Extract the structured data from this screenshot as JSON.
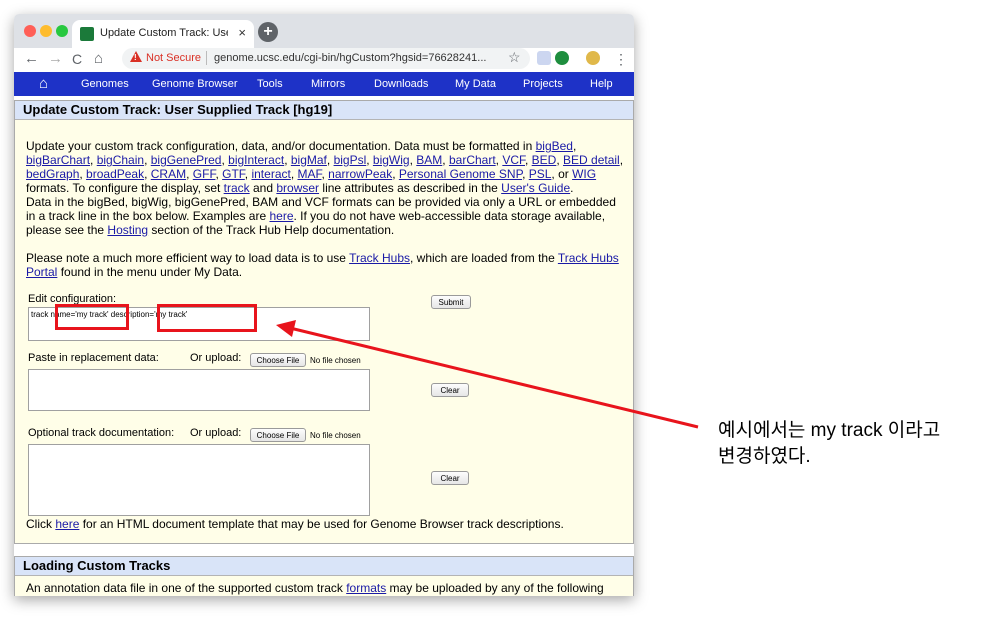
{
  "browser": {
    "tab_title": "Update Custom Track: User Su",
    "tab_close": "×",
    "new_tab": "+",
    "back": "←",
    "forward": "→",
    "reload": "C",
    "home": "⌂",
    "security_label": "Not Secure",
    "url": "genome.ucsc.edu/cgi-bin/hgCustom?hgsid=76628241...",
    "star": "☆",
    "menu": "⋮"
  },
  "nav": {
    "items": [
      "Genomes",
      "Genome Browser",
      "Tools",
      "Mirrors",
      "Downloads",
      "My Data",
      "Projects",
      "Help"
    ]
  },
  "page": {
    "panel_title": "Update Custom Track: User Supplied Track [hg19]",
    "intro": {
      "l1_text": "Update your custom track configuration, data, and/or documentation. Data must be formatted in ",
      "bigBed": "bigBed",
      "comma": ",",
      "bigBarChart": "bigBarChart",
      "bigChain": "bigChain",
      "bigGenePred": "bigGenePred",
      "bigInteract": "bigInteract",
      "bigMaf": "bigMaf",
      "bigPsl": "bigPsl",
      "bigWig": "bigWig",
      "BAM": "BAM",
      "barChart": "barChart",
      "VCF": "VCF",
      "BED": "BED",
      "BED_detail": "BED detail",
      "bedGraph": "bedGraph",
      "broadPeak": "broadPeak",
      "CRAM": "CRAM",
      "GFF": "GFF",
      "GTF": "GTF",
      "interact": "interact",
      "MAF": "MAF",
      "narrowPeak": "narrowPeak",
      "Personal_Genome_SNP": "Personal Genome SNP",
      "PSL": "PSL",
      "or": ", or ",
      "WIG": "WIG",
      "l4_a": "formats. To configure the display, set ",
      "track": "track",
      "and": " and ",
      "browser": "browser",
      "l4_b": " line attributes as described in the ",
      "users_guide": "User's Guide",
      "period": ".",
      "l5": "Data in the bigBed, bigWig, bigGenePred, BAM and VCF formats can be provided via only a URL or embedded",
      "l6_a": "in a track line in the box below. Examples are ",
      "here": "here",
      "l6_b": ". If you do not have web-accessible data storage available,",
      "l7_a": "please see the ",
      "hosting": "Hosting",
      "l7_b": " section of the Track Hub Help documentation."
    },
    "note": {
      "a": "Please note a much more efficient way to load data is to use ",
      "track_hubs": "Track Hubs",
      "b": ", which are loaded from the ",
      "track_hubs_portal_1": "Track Hubs",
      "track_hubs_portal_2": "Portal",
      "c": " found in the menu under My Data."
    },
    "edit_config_label": "Edit configuration:",
    "edit_config_value": "track name='my track' description='my track'",
    "submit": "Submit",
    "paste_label": "Paste in replacement data:",
    "or_upload": "Or upload:",
    "choose_file": "Choose File",
    "no_file": "No file chosen",
    "clear": "Clear",
    "doc_label": "Optional track documentation:",
    "click_a": "Click ",
    "click_here": "here",
    "click_b": " for an HTML document template that may be used for Genome Browser track descriptions.",
    "loading_title": "Loading Custom Tracks",
    "loading_a": "An annotation data file in one of the supported custom track ",
    "loading_formats": "formats",
    "loading_b": " may be uploaded by any of the following"
  },
  "annotation": {
    "line1": "예시에서는 my track 이라고",
    "line2": "변경하였다.",
    "color": "#e8141c"
  }
}
